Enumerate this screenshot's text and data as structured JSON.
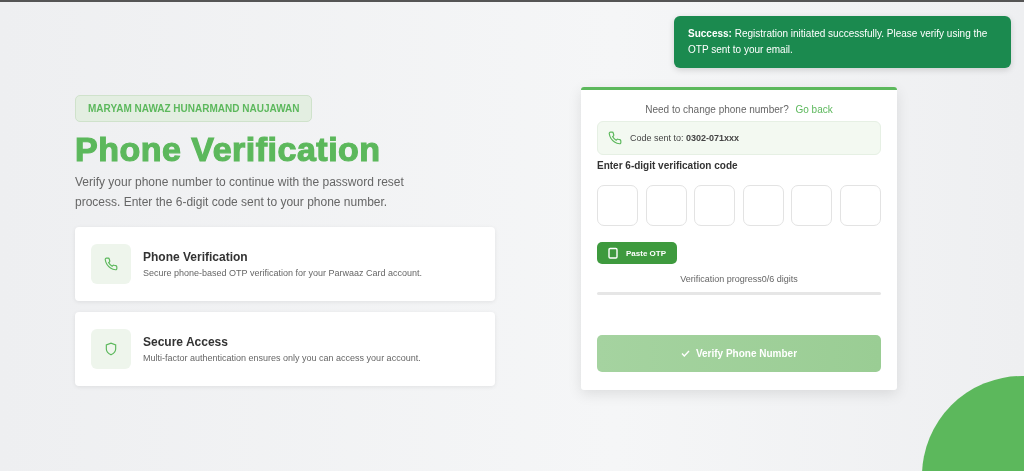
{
  "toast": {
    "text": "**Success:** Registration initiated successfully. Please verify using the OTP sent to your email."
  },
  "badge": "MARYAM NAWAZ HUNARMAND NAUJAWAN",
  "title": "Phone Verification",
  "subtitle": "Verify your phone number to continue with the password reset process. Enter the 6-digit code sent to your phone number.",
  "features": [
    {
      "kind": "phone",
      "title": "Phone Verification",
      "description": "Secure phone-based OTP verification for your Parwaaz Card account."
    },
    {
      "kind": "shield",
      "title": "Secure Access",
      "description": "Multi-factor authentication ensures only you can access your account."
    }
  ],
  "card": {
    "change_prompt": "Need to change phone number?",
    "go_back": "Go back",
    "code_sent": "Code sent to: **0302-071xxx**",
    "code_label": "Enter 6-digit verification code",
    "otp_fields": [
      {
        "filled": false
      },
      {
        "filled": false
      },
      {
        "filled": false
      },
      {
        "filled": false
      },
      {
        "filled": false
      },
      {
        "filled": false
      }
    ],
    "paste_button": "Paste OTP",
    "progress_label": "Verification progress0/6 digits",
    "progress": {
      "level": 0
    },
    "verify_button": {
      "label": "Verify Phone Number",
      "disabled": true
    }
  }
}
